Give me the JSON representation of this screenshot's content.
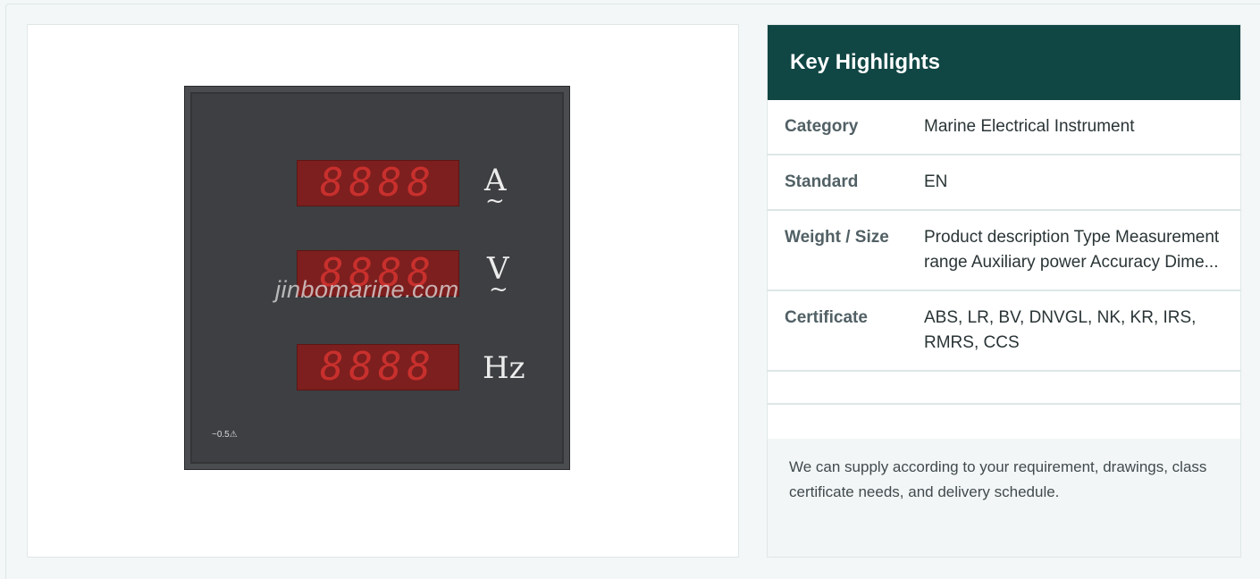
{
  "product_image": {
    "watermark": "jinbomarine.com",
    "displays": [
      {
        "digits": "8888",
        "unit": "A",
        "ac": "~"
      },
      {
        "digits": "8888",
        "unit": "V",
        "ac": "~"
      },
      {
        "digits": "8888",
        "unit": "Hz",
        "ac": ""
      }
    ],
    "accuracy_mark": "~0.5⚠"
  },
  "highlights": {
    "title": "Key Highlights",
    "rows": [
      {
        "label": "Category",
        "value": "Marine Electrical Instrument"
      },
      {
        "label": "Standard",
        "value": "EN"
      },
      {
        "label": "Weight / Size",
        "value": "Product description Type Measurement range Auxiliary power Accuracy Dime..."
      },
      {
        "label": "Certificate",
        "value": "ABS, LR, BV, DNVGL, NK, KR, IRS, RMRS, CCS"
      }
    ],
    "note": "We can supply according to your requirement, drawings, class certificate needs, and delivery schedule."
  },
  "colors": {
    "header_bg": "#104644",
    "led_red": "#c8302d",
    "panel_gray": "#3d3f42"
  }
}
